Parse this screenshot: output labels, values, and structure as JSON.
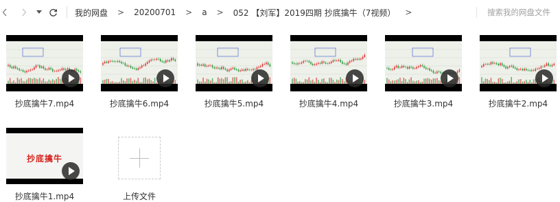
{
  "toolbar": {
    "breadcrumbs": [
      "我的网盘",
      "20200701",
      "a",
      "052 【刘军】2019四期 抄底擒牛（7视频）"
    ],
    "separator": ">",
    "search_placeholder": "搜索我的网盘文件"
  },
  "files": [
    {
      "name": "抄底擒牛7.mp4",
      "thumb_icon": "stock-chart-thumbnail"
    },
    {
      "name": "抄底擒牛6.mp4",
      "thumb_icon": "stock-chart-thumbnail"
    },
    {
      "name": "抄底擒牛5.mp4",
      "thumb_icon": "stock-chart-thumbnail"
    },
    {
      "name": "抄底擒牛4.mp4",
      "thumb_icon": "stock-chart-thumbnail"
    },
    {
      "name": "抄底擒牛3.mp4",
      "thumb_icon": "stock-chart-thumbnail"
    },
    {
      "name": "抄底擒牛2.mp4",
      "thumb_icon": "stock-chart-thumbnail"
    },
    {
      "name": "抄底擒牛1.mp4",
      "thumb_icon": "title-slide-thumbnail",
      "thumb_text": "抄底擒牛"
    }
  ],
  "upload": {
    "label": "上传文件"
  },
  "colors": {
    "accent_red": "#d8231d",
    "candle_up": "#d33",
    "candle_down": "#2a9a3a"
  }
}
